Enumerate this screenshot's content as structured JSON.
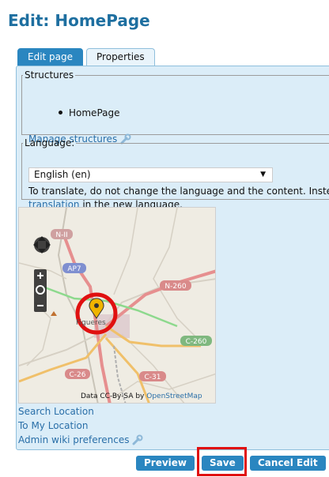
{
  "page": {
    "title": "Edit: HomePage"
  },
  "tabs": [
    {
      "label": "Edit page",
      "active": true
    },
    {
      "label": "Properties",
      "active": false
    }
  ],
  "structures": {
    "legend": "Structures",
    "items": [
      "HomePage"
    ],
    "manage_link": "Manage structures"
  },
  "language": {
    "legend": "Language:",
    "selected": "English (en)",
    "note_text": "To translate, do not change the language and the content. Instead",
    "note_link": "translation",
    "note_suffix": " in the new language."
  },
  "map": {
    "road_labels": [
      "N-II",
      "AP7",
      "N-260",
      "C-260",
      "C-26",
      "C-31"
    ],
    "town_label": "Figueres",
    "attribution_prefix": "Data CC-By-SA by ",
    "attribution_link": "OpenStreetMap"
  },
  "links": {
    "search_location": "Search Location",
    "my_location": "To My Location",
    "admin_prefs": "Admin wiki preferences"
  },
  "buttons": {
    "preview": "Preview",
    "save": "Save",
    "cancel": "Cancel Edit"
  },
  "colors": {
    "accent": "#2a86c0",
    "title": "#1e6fa0",
    "panel_bg": "#dbedf8",
    "highlight": "#e01010"
  }
}
